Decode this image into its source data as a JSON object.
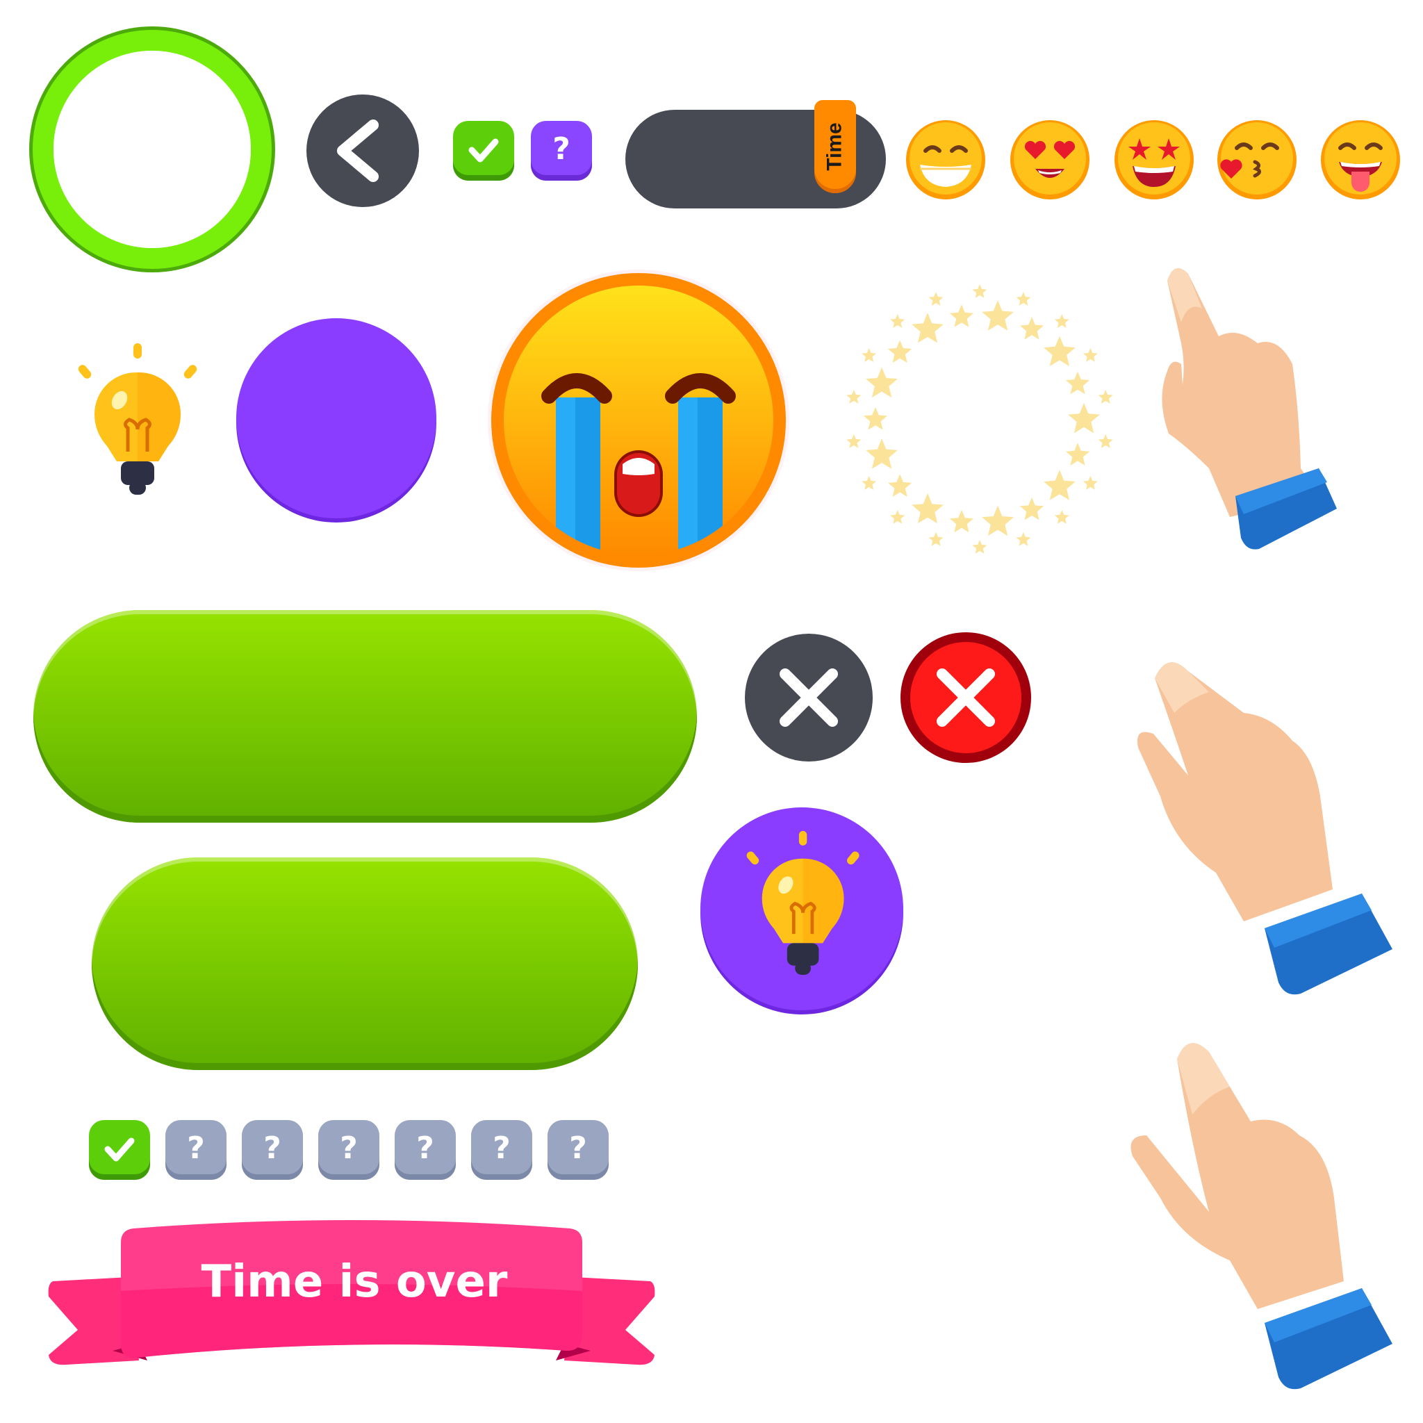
{
  "colors": {
    "green": "#5ccf0a",
    "purple": "#8a45ff",
    "dark": "#474a52",
    "red": "#ff1a1a",
    "orange": "#ff8a00",
    "pink": "#ff2d7a",
    "gray": "#9aa5c2"
  },
  "timer": {
    "label": "Time"
  },
  "square_buttons_top": [
    {
      "icon": "check-icon",
      "state": "correct"
    },
    {
      "icon": "question-icon",
      "label": "?"
    }
  ],
  "progress_squares": [
    {
      "icon": "check-icon",
      "state": "correct"
    },
    {
      "label": "?"
    },
    {
      "label": "?"
    },
    {
      "label": "?"
    },
    {
      "label": "?"
    },
    {
      "label": "?"
    },
    {
      "label": "?"
    }
  ],
  "emojis": [
    "grinning-face-icon",
    "heart-eyes-face-icon",
    "star-struck-face-icon",
    "kissing-heart-face-icon",
    "tongue-out-face-icon"
  ],
  "icons": {
    "back": "chevron-left-icon",
    "close_dark": "close-icon",
    "close_red": "close-icon",
    "hint": "lightbulb-icon",
    "crying": "crying-face-icon",
    "stars": "star-ring-icon",
    "hands": "pointing-hand-icon"
  },
  "ribbon": {
    "text": "Time is over"
  }
}
